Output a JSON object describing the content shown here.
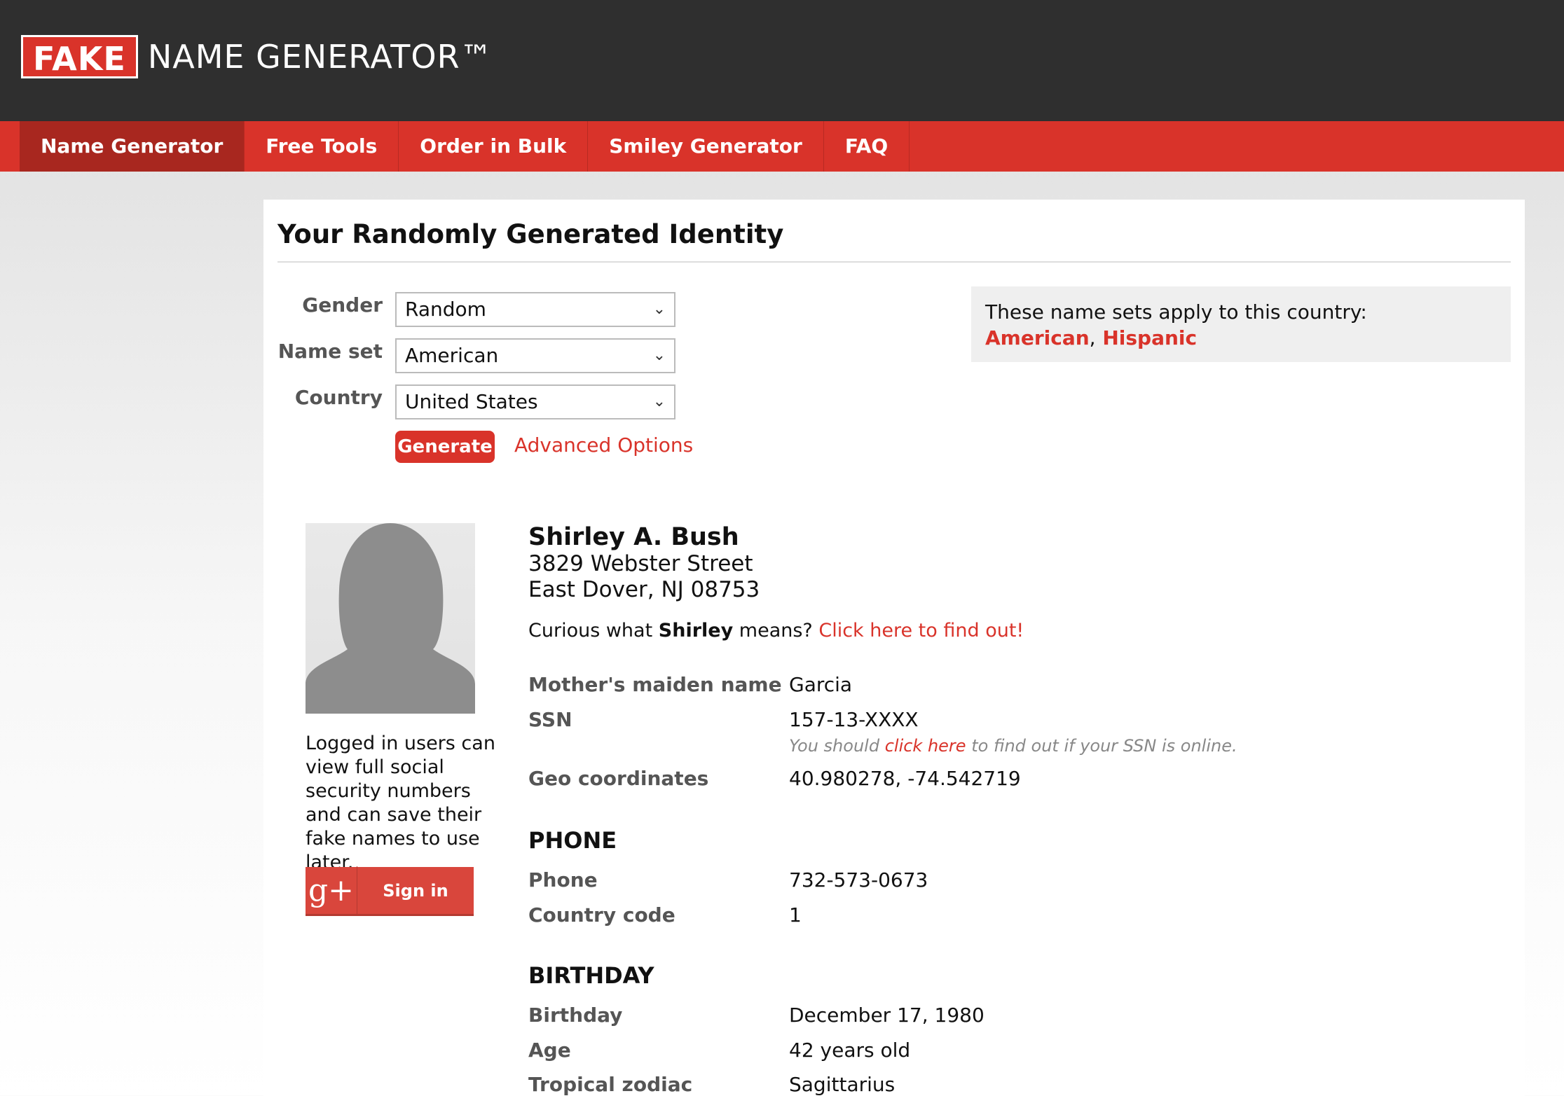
{
  "header": {
    "logo_fake": "FAKE",
    "logo_rest": "NAME GENERATOR™"
  },
  "nav": [
    {
      "label": "Name Generator"
    },
    {
      "label": "Free Tools"
    },
    {
      "label": "Order in Bulk"
    },
    {
      "label": "Smiley Generator"
    },
    {
      "label": "FAQ"
    }
  ],
  "panel": {
    "title": "Your Randomly Generated Identity"
  },
  "form": {
    "gender_label": "Gender",
    "gender_value": "Random",
    "nameset_label": "Name set",
    "nameset_value": "American",
    "country_label": "Country",
    "country_value": "United States",
    "generate_label": "Generate",
    "advanced_label": "Advanced Options"
  },
  "country_box": {
    "text": "These name sets apply to this country:",
    "set1": "American",
    "sep": ",",
    "set2": "Hispanic"
  },
  "sidebar": {
    "login_text": "Logged in users can view full social security numbers and can save their fake names to use later.",
    "gplus_icon": "g+",
    "signin_label": "Sign in"
  },
  "identity": {
    "name": "Shirley A. Bush",
    "street": "3829 Webster Street",
    "city": "East Dover, NJ 08753",
    "curious_pre": "Curious what",
    "first_name": "Shirley",
    "curious_mid": "means?",
    "curious_link": "Click here to find out!",
    "maiden_label": "Mother's maiden name",
    "maiden_value": "Garcia",
    "ssn_label": "SSN",
    "ssn_value": "157-13-XXXX",
    "ssn_note_pre": "You should",
    "ssn_note_link": "click here",
    "ssn_note_post": "to find out if your SSN is online.",
    "geo_label": "Geo coordinates",
    "geo_value": "40.980278, -74.542719"
  },
  "phone": {
    "section": "PHONE",
    "phone_label": "Phone",
    "phone_value": "732-573-0673",
    "cc_label": "Country code",
    "cc_value": "1"
  },
  "birthday": {
    "section": "BIRTHDAY",
    "birthday_label": "Birthday",
    "birthday_value": "December 17, 1980",
    "age_label": "Age",
    "age_value": "42 years old",
    "zodiac_label": "Tropical zodiac",
    "zodiac_value": "Sagittarius"
  },
  "colors": {
    "brand_red": "#d9332a",
    "dark_header": "#2f2f2f"
  }
}
